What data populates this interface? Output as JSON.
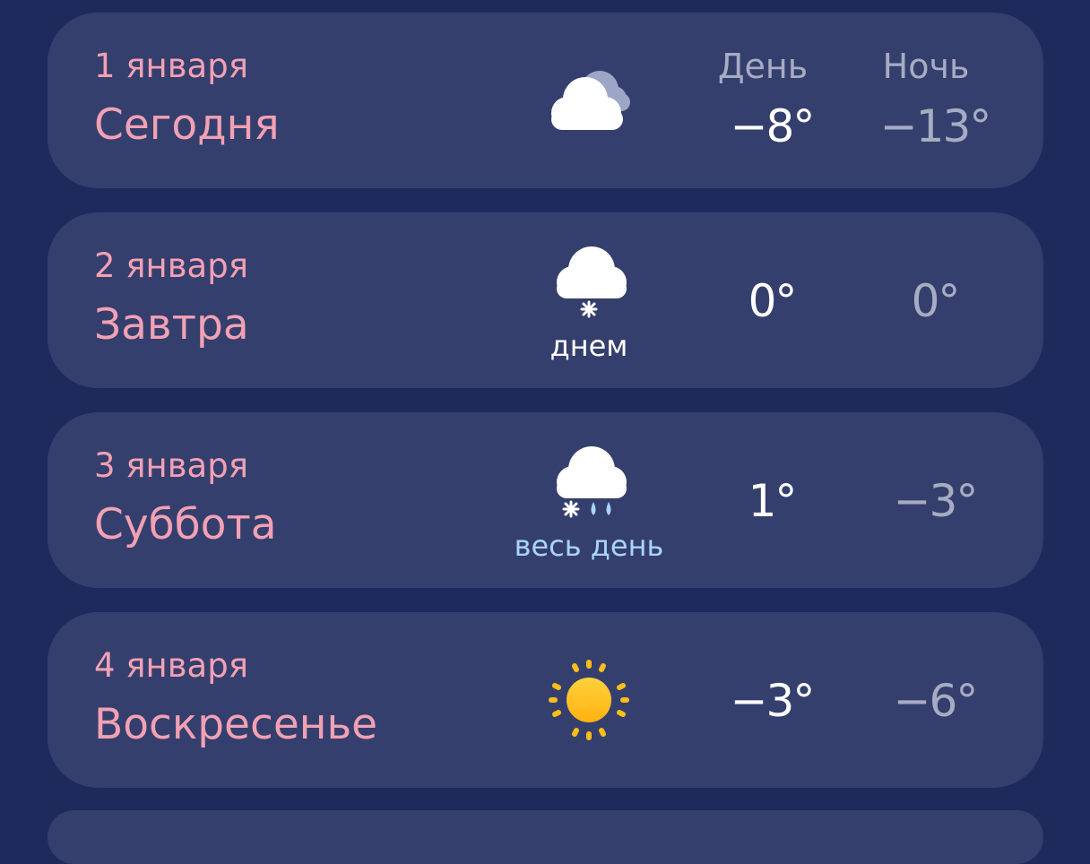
{
  "headers": {
    "day": "День",
    "night": "Ночь"
  },
  "days": [
    {
      "date": "1 января",
      "name": "Сегодня",
      "day_temp": "−8°",
      "night_temp": "−13°",
      "icon": "partly-cloudy-icon",
      "note": ""
    },
    {
      "date": "2 января",
      "name": "Завтра",
      "day_temp": "0°",
      "night_temp": "0°",
      "icon": "cloud-snow-icon",
      "note": "днем",
      "note_color": "#ffffff"
    },
    {
      "date": "3 января",
      "name": "Суббота",
      "day_temp": "1°",
      "night_temp": "−3°",
      "icon": "cloud-snow-rain-icon",
      "note": "весь день",
      "note_color": "#a9d4ff"
    },
    {
      "date": "4 января",
      "name": "Воскресенье",
      "day_temp": "−3°",
      "night_temp": "−6°",
      "icon": "sun-icon",
      "note": ""
    }
  ],
  "colors": {
    "background": "#1f2a5c",
    "card": "#353f6d",
    "accent_pink": "#f2a1b4",
    "muted": "#a7acc3",
    "sun": "#ffbd1a"
  }
}
